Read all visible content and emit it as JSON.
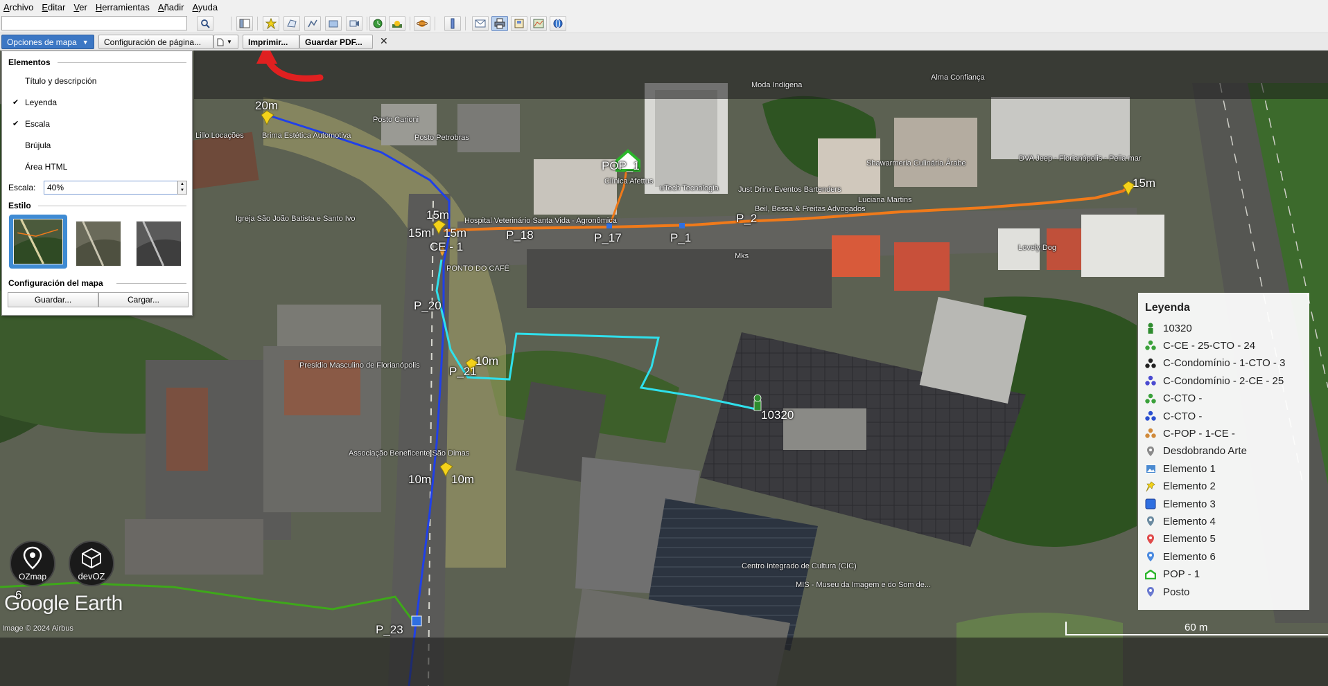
{
  "menubar": {
    "items": [
      "Archivo",
      "Editar",
      "Ver",
      "Herramientas",
      "Añadir",
      "Ayuda"
    ]
  },
  "toolbar": {
    "search_value": "",
    "icons": [
      "search-icon",
      "sidebar-icon",
      "placemark-icon",
      "polygon-icon",
      "path-icon",
      "overlay-icon",
      "tour-icon",
      "historical-imagery-icon",
      "sunlight-icon",
      "planets-icon",
      "ruler-icon",
      "email-icon",
      "print-icon",
      "save-image-icon",
      "maps-icon",
      "web-icon"
    ]
  },
  "printbar": {
    "map_options": "Opciones de mapa",
    "page_setup": "Configuración de página...",
    "print": "Imprimir...",
    "save_pdf": "Guardar PDF...",
    "close": "✕"
  },
  "options_panel": {
    "elements_heading": "Elementos",
    "items": [
      {
        "label": "Título y descripción",
        "checked": false
      },
      {
        "label": "Leyenda",
        "checked": true
      },
      {
        "label": "Escala",
        "checked": true
      },
      {
        "label": "Brújula",
        "checked": false
      },
      {
        "label": "Área HTML",
        "checked": false
      }
    ],
    "scale_label": "Escala:",
    "scale_value": "40%",
    "style_heading": "Estilo",
    "config_heading": "Configuración del mapa",
    "save_button": "Guardar...",
    "load_button": "Cargar..."
  },
  "legend": {
    "title": "Leyenda",
    "items": [
      {
        "label": "10320",
        "icon": "person-icon",
        "color": "#2e8b2e"
      },
      {
        "label": "C-CE - 25-CTO - 24",
        "icon": "cluster-icon",
        "color": "#3aa13a"
      },
      {
        "label": "C-Condomínio - 1-CTO - 3",
        "icon": "cluster-icon",
        "color": "#222222"
      },
      {
        "label": "C-Condomínio - 2-CE - 25",
        "icon": "cluster-icon",
        "color": "#4a4ad0"
      },
      {
        "label": "C-CTO -",
        "icon": "cluster-icon",
        "color": "#3aa13a"
      },
      {
        "label": "C-CTO -",
        "icon": "cluster-icon",
        "color": "#2a4fd0"
      },
      {
        "label": "C-POP - 1-CE -",
        "icon": "cluster-icon",
        "color": "#d08a3a"
      },
      {
        "label": "Desdobrando Arte",
        "icon": "pin-icon",
        "color": "#8a8a8a"
      },
      {
        "label": "Elemento 1",
        "icon": "image-icon",
        "color": "#4a8ad0"
      },
      {
        "label": "Elemento 2",
        "icon": "pushpin-icon",
        "color": "#f2d21a"
      },
      {
        "label": "Elemento 3",
        "icon": "square-icon",
        "color": "#2f6fe0"
      },
      {
        "label": "Elemento 4",
        "icon": "pin-icon",
        "color": "#6a8aa0"
      },
      {
        "label": "Elemento 5",
        "icon": "pin-icon",
        "color": "#e04a4a"
      },
      {
        "label": "Elemento 6",
        "icon": "pin-icon",
        "color": "#4a8ae0"
      },
      {
        "label": "POP - 1",
        "icon": "home-icon",
        "color": "#2bb52b"
      },
      {
        "label": "Posto",
        "icon": "pin-icon",
        "color": "#6a7ad0"
      }
    ]
  },
  "scalebar": {
    "label": "60 m"
  },
  "branding": {
    "ozmap": "OZmap",
    "devoz": "devOZ",
    "google_earth": "Google Earth",
    "copyright": "Image © 2024 Airbus"
  },
  "map_labels": {
    "distances": [
      "20m",
      "15m",
      "15m",
      "15m",
      "10m",
      "10m",
      "10m",
      "15m"
    ],
    "poles": [
      "P_18",
      "P_17",
      "P_1",
      "P_2",
      "P_20",
      "P_21",
      "P_23",
      "CE - 1",
      "POP_1",
      "6"
    ],
    "client": "10320",
    "places": [
      "Brima Estética Automotiva",
      "Posto Carioni",
      "Posto Petrobras",
      "Clínica Afettus",
      "uTech Tecnologia",
      "Just Drinx Eventos Bartenders",
      "Shawarmeria Culinária Árabe",
      "DVA Jeep - Florianópolis - Peiia mar",
      "Hospital Veterinário Santa Vida - Agronômica",
      "Igreja São João Batista e Santo Ivo",
      "Presídio Masculino de Florianópolis",
      "Associação Beneficente São Dimas",
      "Centro Integrado de Cultura (CIC)",
      "MIS - Museu da Imagem e do Som de...",
      "Lovely Dog",
      "Luciana Martins",
      "Beil, Bessa & Freitas Advogados",
      "Mks",
      "PONTO DO CAFÉ",
      "Moda Indígena",
      "Alma Confiança",
      "Lillo Locações"
    ]
  },
  "colors": {
    "route_orange": "#f07a1a",
    "route_cyan": "#2fe0ec",
    "route_blue": "#2040e8",
    "route_green": "#3ea81a",
    "accent_blue": "#3c77c4",
    "arrow_red": "#e02020"
  }
}
